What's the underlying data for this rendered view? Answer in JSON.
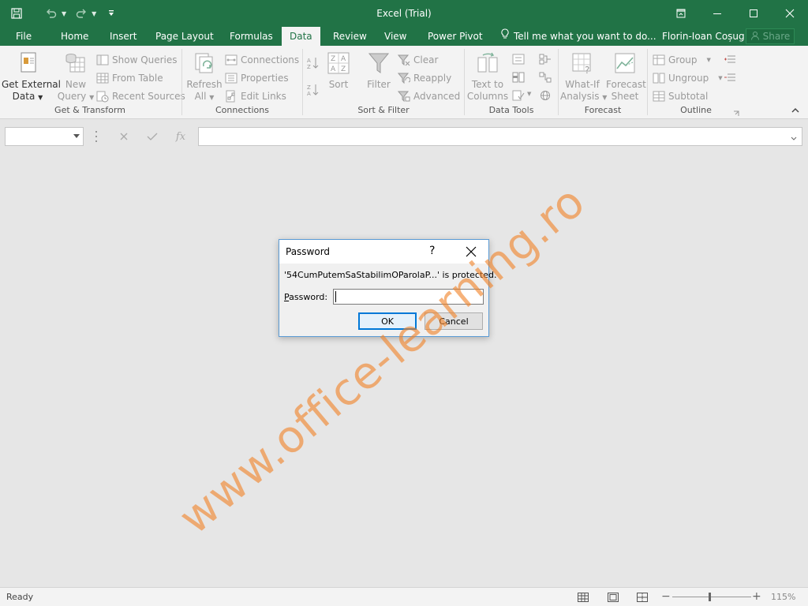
{
  "window": {
    "title": "Excel (Trial)"
  },
  "tabs": {
    "items": [
      "File",
      "Home",
      "Insert",
      "Page Layout",
      "Formulas",
      "Data",
      "Review",
      "View",
      "Power Pivot"
    ],
    "active": "Data",
    "tell_me": "Tell me what you want to do...",
    "user": "Florin-Ioan Coșug",
    "share": "Share"
  },
  "ribbon": {
    "get_transform": {
      "label": "Get & Transform",
      "get_external_data": [
        "Get External",
        "Data"
      ],
      "new_query": [
        "New",
        "Query"
      ],
      "show_queries": "Show Queries",
      "from_table": "From Table",
      "recent_sources": "Recent Sources"
    },
    "connections": {
      "label": "Connections",
      "refresh_all": [
        "Refresh",
        "All"
      ],
      "connections": "Connections",
      "properties": "Properties",
      "edit_links": "Edit Links"
    },
    "sort_filter": {
      "label": "Sort & Filter",
      "sort": "Sort",
      "filter": "Filter",
      "clear": "Clear",
      "reapply": "Reapply",
      "advanced": "Advanced"
    },
    "data_tools": {
      "label": "Data Tools",
      "text_to_columns": [
        "Text to",
        "Columns"
      ]
    },
    "forecast": {
      "label": "Forecast",
      "what_if": [
        "What-If",
        "Analysis"
      ],
      "forecast_sheet": [
        "Forecast",
        "Sheet"
      ]
    },
    "outline": {
      "label": "Outline",
      "group": "Group",
      "ungroup": "Ungroup",
      "subtotal": "Subtotal"
    }
  },
  "formula_bar": {
    "name_box": "",
    "formula": "",
    "fx": "fx"
  },
  "watermark": "www.office-learning.ro",
  "dialog": {
    "title": "Password",
    "help": "?",
    "message": "'54CumPutemSaStabilimOParolaP...' is protected.",
    "password_label_pre": "",
    "password_label_u": "P",
    "password_label_post": "assword:",
    "password_value": "",
    "ok": "OK",
    "cancel": "Cancel"
  },
  "status": {
    "ready": "Ready",
    "zoom": "115%"
  },
  "colors": {
    "brand": "#217346",
    "watermark": "#f08228",
    "dialog_border": "#5b9bd5",
    "ok_border": "#0078d7"
  }
}
